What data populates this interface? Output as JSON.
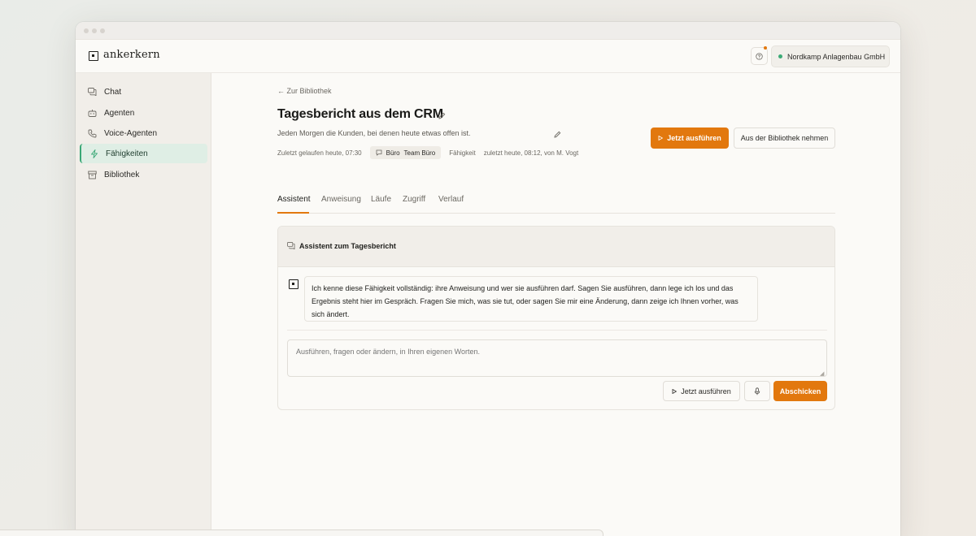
{
  "app": {
    "name": "ankerkern",
    "org": "Nordkamp Anlagenbau GmbH"
  },
  "colors": {
    "accent": "#e2780e",
    "active_nav": "#3aa876",
    "status_online": "#3caa76"
  },
  "icons": {
    "help": "question-circle-icon",
    "chat": "chat-bubbles-icon",
    "agents": "robot-icon",
    "voice": "phone-icon",
    "skills": "lightning-icon",
    "library": "archive-box-icon",
    "edit": "pencil-icon",
    "run": "play-icon",
    "mic": "microphone-icon"
  },
  "sidebar": {
    "items": [
      {
        "label": "Chat"
      },
      {
        "label": "Agenten"
      },
      {
        "label": "Voice-Agenten"
      },
      {
        "label": "Fähigkeiten"
      },
      {
        "label": "Bibliothek"
      }
    ],
    "active": "Fähigkeiten"
  },
  "page": {
    "back_label": "← Zur Bibliothek",
    "title": "Tagesbericht aus dem CRM",
    "subtitle": "Jeden Morgen die Kunden, bei denen heute etwas offen ist.",
    "last_run": "Zuletzt gelaufen heute, 07:30",
    "tag_main": "Büro",
    "tag_sub": "Team Büro",
    "type_label": "Fähigkeit",
    "changed": "zuletzt heute, 08:12, von M. Vogt",
    "run_now_label": "Jetzt ausführen",
    "remove_label": "Aus der Bibliothek nehmen"
  },
  "tabs": [
    {
      "label": "Assistent"
    },
    {
      "label": "Anweisung"
    },
    {
      "label": "Läufe"
    },
    {
      "label": "Zugriff"
    },
    {
      "label": "Verlauf"
    }
  ],
  "assistant": {
    "title": "Assistent zum Tagesbericht",
    "message": "Ich kenne diese Fähigkeit vollständig: ihre Anweisung und wer sie ausführen darf. Sagen Sie ausführen, dann lege ich los und das Ergebnis steht hier im Gespräch. Fragen Sie mich, was sie tut, oder sagen Sie mir eine Änderung, dann zeige ich Ihnen vorher, was sich ändert.",
    "placeholder": "Ausführen, fragen oder ändern, in Ihren eigenen Worten.",
    "run_label": "Jetzt ausführen",
    "send_label": "Abschicken"
  }
}
